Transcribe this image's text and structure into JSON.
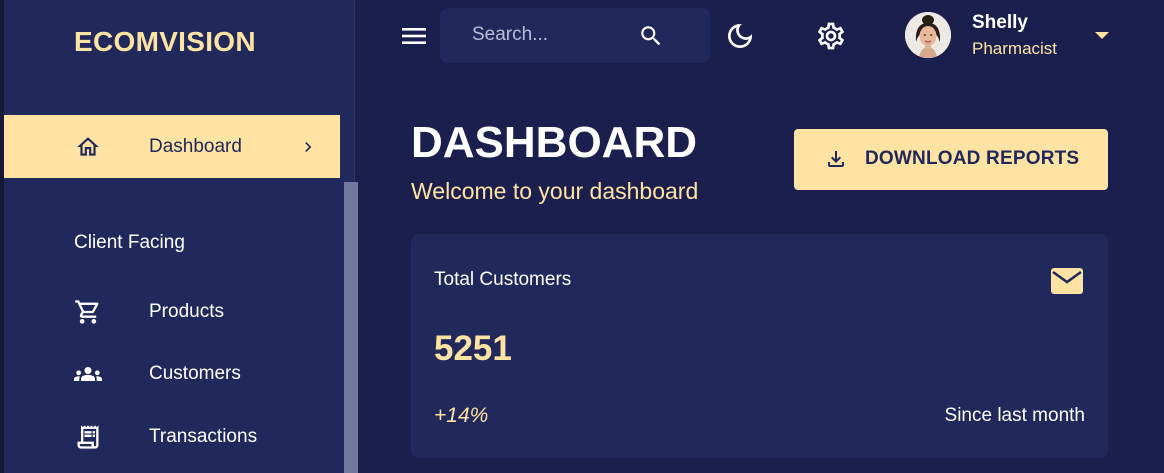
{
  "app": {
    "brand": "ECOMVISION"
  },
  "sidebar": {
    "items": [
      {
        "label": "Dashboard",
        "icon": "home-icon",
        "active": true
      },
      {
        "label": "Products",
        "icon": "cart-icon"
      },
      {
        "label": "Customers",
        "icon": "groups-icon"
      },
      {
        "label": "Transactions",
        "icon": "receipt-icon"
      }
    ],
    "section": "Client Facing"
  },
  "topbar": {
    "search_placeholder": "Search...",
    "user": {
      "name": "Shelly",
      "role": "Pharmacist"
    }
  },
  "header": {
    "title": "DASHBOARD",
    "subtitle": "Welcome to your dashboard",
    "download_label": "DOWNLOAD REPORTS"
  },
  "stat_card": {
    "title": "Total Customers",
    "value": "5251",
    "change": "+14%",
    "since": "Since last month",
    "icon": "email-icon"
  },
  "colors": {
    "background": "#1a1f4d",
    "panel": "#21295c",
    "accent": "#ffe3a3",
    "text": "#ffffff"
  }
}
